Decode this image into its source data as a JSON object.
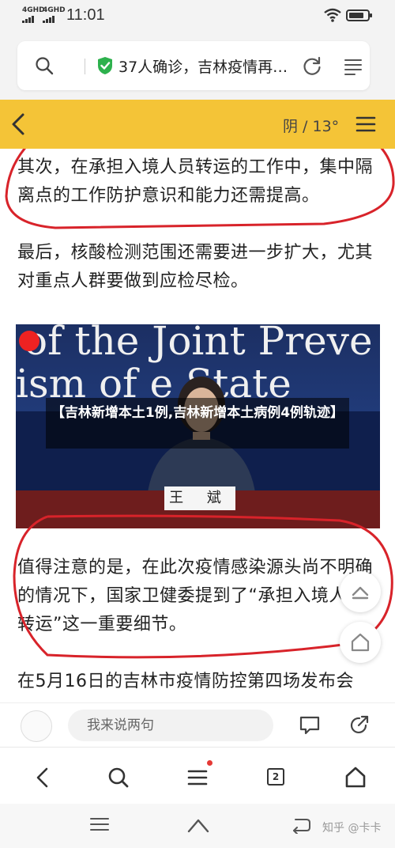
{
  "status_bar": {
    "signal1": "4GHD",
    "signal2": "4GHD",
    "time": "11:01",
    "battery_level": 0.82
  },
  "address_bar": {
    "title": "37人确诊，吉林疫情再…",
    "verified_color": "#2db14d"
  },
  "article_header": {
    "weather": "阴 / 13°",
    "accent_color": "#f4c437"
  },
  "article": {
    "paragraph1": "其次，在承担入境人员转运的工作中，集中隔离点的工作防护意识和能力还需提高。",
    "paragraph2": "最后，核酸检测范围还需要进一步扩大，尤其对重点人群要做到应检尽检。",
    "video": {
      "caption": "【吉林新增本土1例,吉林新增本土病例4例轨迹】",
      "background_text_line1": "of the Joint Preve",
      "background_text_line2": "ism of  e State",
      "nameplate": "王  斌"
    },
    "paragraph3": "值得注意的是，在此次疫情感染源头尚不明确的情况下，国家卫健委提到了“承担入境人员转运”这一重要细节。",
    "paragraph4": "在5月16日的吉林市疫情防控第四场发布会"
  },
  "comment_bar": {
    "placeholder": "我来说两句"
  },
  "browser_nav": {
    "tab_count": "2"
  },
  "watermark": "知乎 @卡卡",
  "icons": {
    "address_bar": [
      "search-icon",
      "shield-check-icon",
      "reload-icon",
      "menu-lines-icon"
    ],
    "header": [
      "back-chevron-icon",
      "hamburger-icon"
    ],
    "float": [
      "chevron-up-icon",
      "home-icon"
    ],
    "comment_bar": [
      "comment-icon",
      "share-icon"
    ],
    "browser_nav": [
      "back-icon",
      "search-icon",
      "menu-icon",
      "tabs-icon",
      "home-icon"
    ],
    "system_nav": [
      "menu-icon",
      "home-icon",
      "back-icon"
    ]
  },
  "annotation_color": "#d8232a"
}
